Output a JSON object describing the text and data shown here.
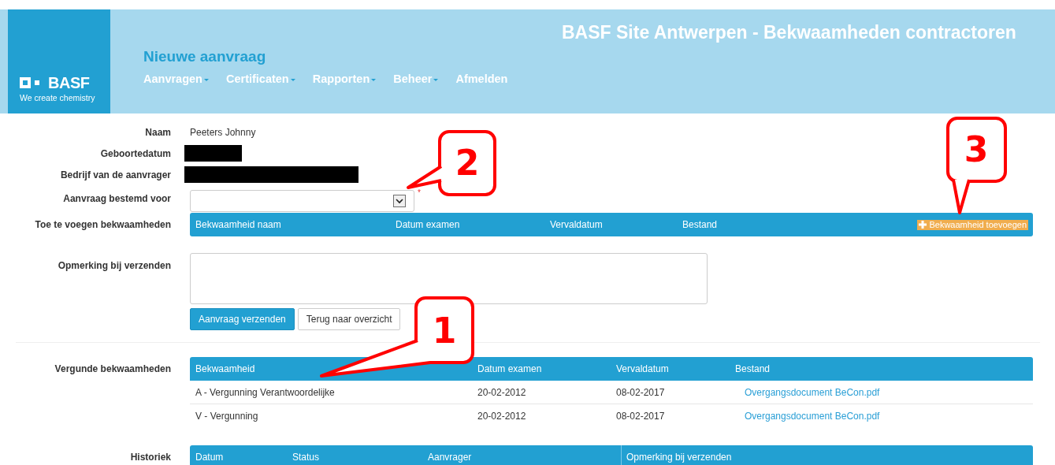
{
  "header": {
    "logo": {
      "wordmark": "BASF",
      "tagline": "We create chemistry"
    },
    "site_title": "BASF Site Antwerpen - Bekwaamheden contractoren",
    "page_title": "Nieuwe aanvraag",
    "nav": [
      {
        "label": "Aanvragen",
        "has_menu": true
      },
      {
        "label": "Certificaten",
        "has_menu": true
      },
      {
        "label": "Rapporten",
        "has_menu": true
      },
      {
        "label": "Beheer",
        "has_menu": true
      },
      {
        "label": "Afmelden",
        "has_menu": false
      }
    ]
  },
  "form": {
    "fields": [
      {
        "kind": "text",
        "label": "Naam",
        "value": "Peeters Johnny"
      },
      {
        "kind": "redacted",
        "label": "Geboortedatum"
      },
      {
        "kind": "redacted",
        "label": "Bedrijf van de aanvrager"
      },
      {
        "kind": "select",
        "label": "Aanvraag bestemd voor",
        "required_mark": "*"
      }
    ],
    "add_table": {
      "label": "Toe te voegen bekwaamheden",
      "columns": [
        "Bekwaamheid naam",
        "Datum examen",
        "Vervaldatum",
        "Bestand"
      ],
      "add_button": "Bekwaamheid toevoegen"
    },
    "remark": {
      "label": "Opmerking bij verzenden"
    },
    "buttons": [
      {
        "label": "Aanvraag verzenden",
        "kind": "primary"
      },
      {
        "label": "Terug naar overzicht",
        "kind": "default"
      }
    ]
  },
  "granted": {
    "label": "Vergunde bekwaamheden",
    "columns": [
      "Bekwaamheid",
      "Datum examen",
      "Vervaldatum",
      "Bestand"
    ],
    "rows": [
      [
        "A - Vergunning Verantwoordelijke",
        "20-02-2012",
        "08-02-2017",
        "Overgangsdocument BeCon.pdf"
      ],
      [
        "V - Vergunning",
        "20-02-2012",
        "08-02-2017",
        "Overgangsdocument BeCon.pdf"
      ]
    ]
  },
  "history": {
    "label": "Historiek",
    "columns": [
      "Datum",
      "Status",
      "Aanvrager",
      "Opmerking bij verzenden"
    ]
  },
  "annotations": [
    {
      "number": "2"
    },
    {
      "number": "3"
    },
    {
      "number": "1"
    }
  ]
}
